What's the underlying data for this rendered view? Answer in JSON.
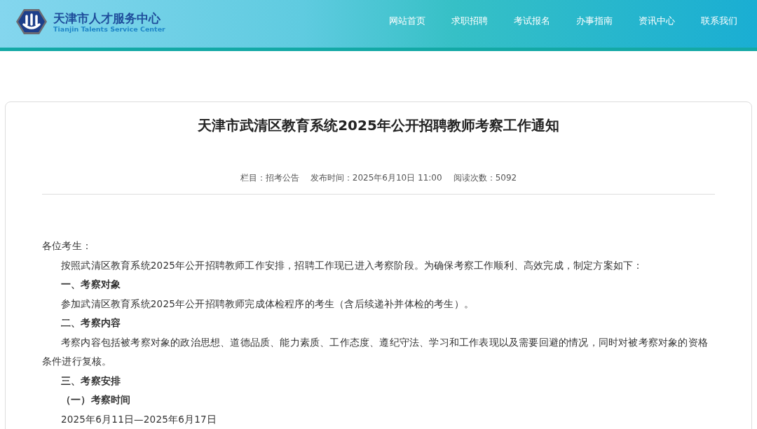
{
  "header": {
    "logo_title": "天津市人才服务中心",
    "logo_subtitle": "Tianjin Talents Service Center",
    "nav": [
      {
        "label": "网站首页"
      },
      {
        "label": "求职招聘"
      },
      {
        "label": "考试报名"
      },
      {
        "label": "办事指南"
      },
      {
        "label": "资讯中心"
      },
      {
        "label": "联系我们"
      }
    ]
  },
  "article": {
    "title": "天津市武清区教育系统2025年公开招聘教师考察工作通知",
    "meta": [
      "栏目：招考公告",
      "发布时间：2025年6月10日 11:00",
      "阅读次数：5092"
    ],
    "paragraphs": [
      {
        "kind": "plain",
        "text": "各位考生："
      },
      {
        "kind": "indent",
        "text": "按照武清区教育系统2025年公开招聘教师工作安排，招聘工作现已进入考察阶段。为确保考察工作顺利、高效完成，制定方案如下："
      },
      {
        "kind": "heading",
        "text": "一、考察对象"
      },
      {
        "kind": "indent",
        "text": "参加武清区教育系统2025年公开招聘教师完成体检程序的考生（含后续递补并体检的考生）。"
      },
      {
        "kind": "heading",
        "text": "二、考察内容"
      },
      {
        "kind": "indent",
        "text": "考察内容包括被考察对象的政治思想、道德品质、能力素质、工作态度、遵纪守法、学习和工作表现以及需要回避的情况，同时对被考察对象的资格条件进行复核。"
      },
      {
        "kind": "heading",
        "text": "三、考察安排"
      },
      {
        "kind": "heading",
        "text": "（一）考察时间"
      },
      {
        "kind": "indent",
        "text": "2025年6月11日—2025年6月17日"
      }
    ]
  }
}
